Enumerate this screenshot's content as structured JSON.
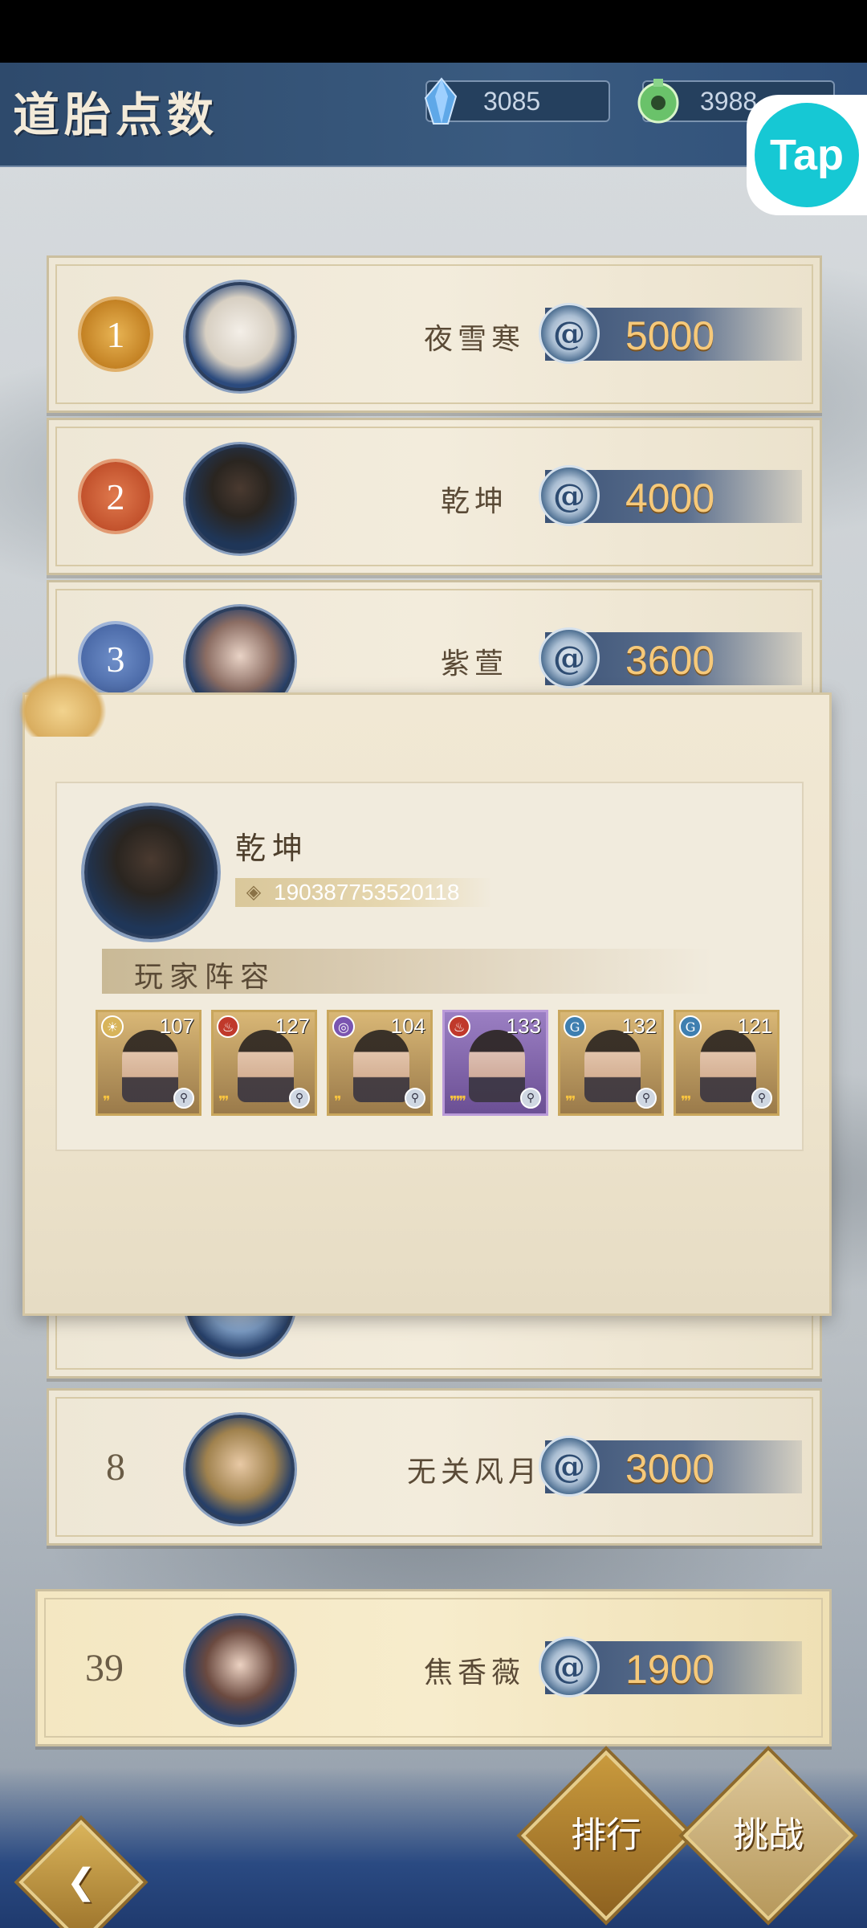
{
  "header": {
    "title": "道胎点数",
    "crystal_amount": "3085",
    "jade_amount": "3988",
    "tap_label": "Tap"
  },
  "ranking": [
    {
      "rank": "1",
      "name": "夜雪寒",
      "score": "5000"
    },
    {
      "rank": "2",
      "name": "乾坤",
      "score": "4000"
    },
    {
      "rank": "3",
      "name": "紫萱",
      "score": "3600"
    },
    {
      "rank": "8",
      "name": "无关风月",
      "score": "3000"
    }
  ],
  "my_rank": {
    "rank": "39",
    "name": "焦香薇",
    "score": "1900"
  },
  "popup": {
    "player_name": "乾坤",
    "player_id": "190387753520118",
    "lineup_title": "玩家阵容",
    "heroes": [
      {
        "level": "107",
        "element": "sun",
        "stars": 2
      },
      {
        "level": "127",
        "element": "fire",
        "stars": 3
      },
      {
        "level": "104",
        "element": "void",
        "stars": 2
      },
      {
        "level": "133",
        "element": "fire",
        "stars": 5
      },
      {
        "level": "132",
        "element": "water",
        "stars": 3
      },
      {
        "level": "121",
        "element": "water",
        "stars": 3
      }
    ]
  },
  "bottom_nav": {
    "rank_label": "排行",
    "challenge_label": "挑战"
  },
  "colors": {
    "header_blue": "#3a5b80",
    "score_gold": "#f6c97a",
    "tap_cyan": "#16c8d4"
  }
}
